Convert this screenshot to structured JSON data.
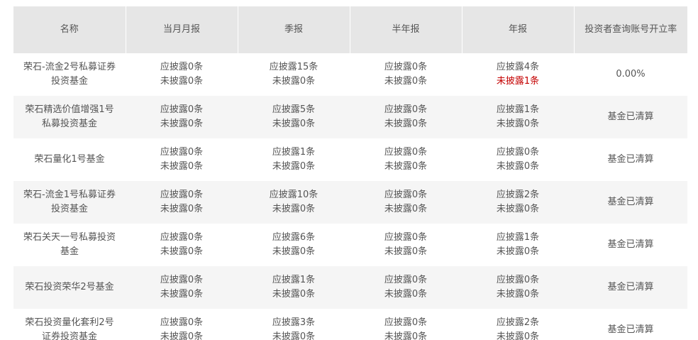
{
  "colors": {
    "header_bg": "#e6e6e6",
    "alt_row_bg": "#f5f5f5",
    "text": "#555555",
    "warning_text": "#c40000"
  },
  "table": {
    "headers": [
      "名称",
      "当月月报",
      "季报",
      "半年报",
      "年报",
      "投资者查询账号开立率"
    ],
    "rows": [
      {
        "name": "荣石-流金2号私募证券投资基金",
        "monthly": [
          "应披露0条",
          "未披露0条"
        ],
        "quarterly": [
          "应披露15条",
          "未披露0条"
        ],
        "semiannual": [
          "应披露0条",
          "未披露0条"
        ],
        "annual": [
          "应披露4条",
          "未披露1条"
        ],
        "annual_unreported_warning": true,
        "rate": "0.00%"
      },
      {
        "name": "荣石精选价值增强1号私募投资基金",
        "monthly": [
          "应披露0条",
          "未披露0条"
        ],
        "quarterly": [
          "应披露5条",
          "未披露0条"
        ],
        "semiannual": [
          "应披露0条",
          "未披露0条"
        ],
        "annual": [
          "应披露1条",
          "未披露0条"
        ],
        "annual_unreported_warning": false,
        "rate": "基金已清算"
      },
      {
        "name": "荣石量化1号基金",
        "monthly": [
          "应披露0条",
          "未披露0条"
        ],
        "quarterly": [
          "应披露1条",
          "未披露0条"
        ],
        "semiannual": [
          "应披露0条",
          "未披露0条"
        ],
        "annual": [
          "应披露0条",
          "未披露0条"
        ],
        "annual_unreported_warning": false,
        "rate": "基金已清算"
      },
      {
        "name": "荣石-流金1号私募证券投资基金",
        "monthly": [
          "应披露0条",
          "未披露0条"
        ],
        "quarterly": [
          "应披露10条",
          "未披露0条"
        ],
        "semiannual": [
          "应披露0条",
          "未披露0条"
        ],
        "annual": [
          "应披露2条",
          "未披露0条"
        ],
        "annual_unreported_warning": false,
        "rate": "基金已清算"
      },
      {
        "name": "荣石关天一号私募投资基金",
        "monthly": [
          "应披露0条",
          "未披露0条"
        ],
        "quarterly": [
          "应披露6条",
          "未披露0条"
        ],
        "semiannual": [
          "应披露0条",
          "未披露0条"
        ],
        "annual": [
          "应披露1条",
          "未披露0条"
        ],
        "annual_unreported_warning": false,
        "rate": "基金已清算"
      },
      {
        "name": "荣石投资荣华2号基金",
        "monthly": [
          "应披露0条",
          "未披露0条"
        ],
        "quarterly": [
          "应披露1条",
          "未披露0条"
        ],
        "semiannual": [
          "应披露0条",
          "未披露0条"
        ],
        "annual": [
          "应披露0条",
          "未披露0条"
        ],
        "annual_unreported_warning": false,
        "rate": "基金已清算"
      },
      {
        "name": "荣石投资量化套利2号证券投资基金",
        "monthly": [
          "应披露0条",
          "未披露0条"
        ],
        "quarterly": [
          "应披露3条",
          "未披露0条"
        ],
        "semiannual": [
          "应披露0条",
          "未披露0条"
        ],
        "annual": [
          "应披露2条",
          "未披露0条"
        ],
        "annual_unreported_warning": false,
        "rate": "基金已清算"
      }
    ]
  }
}
